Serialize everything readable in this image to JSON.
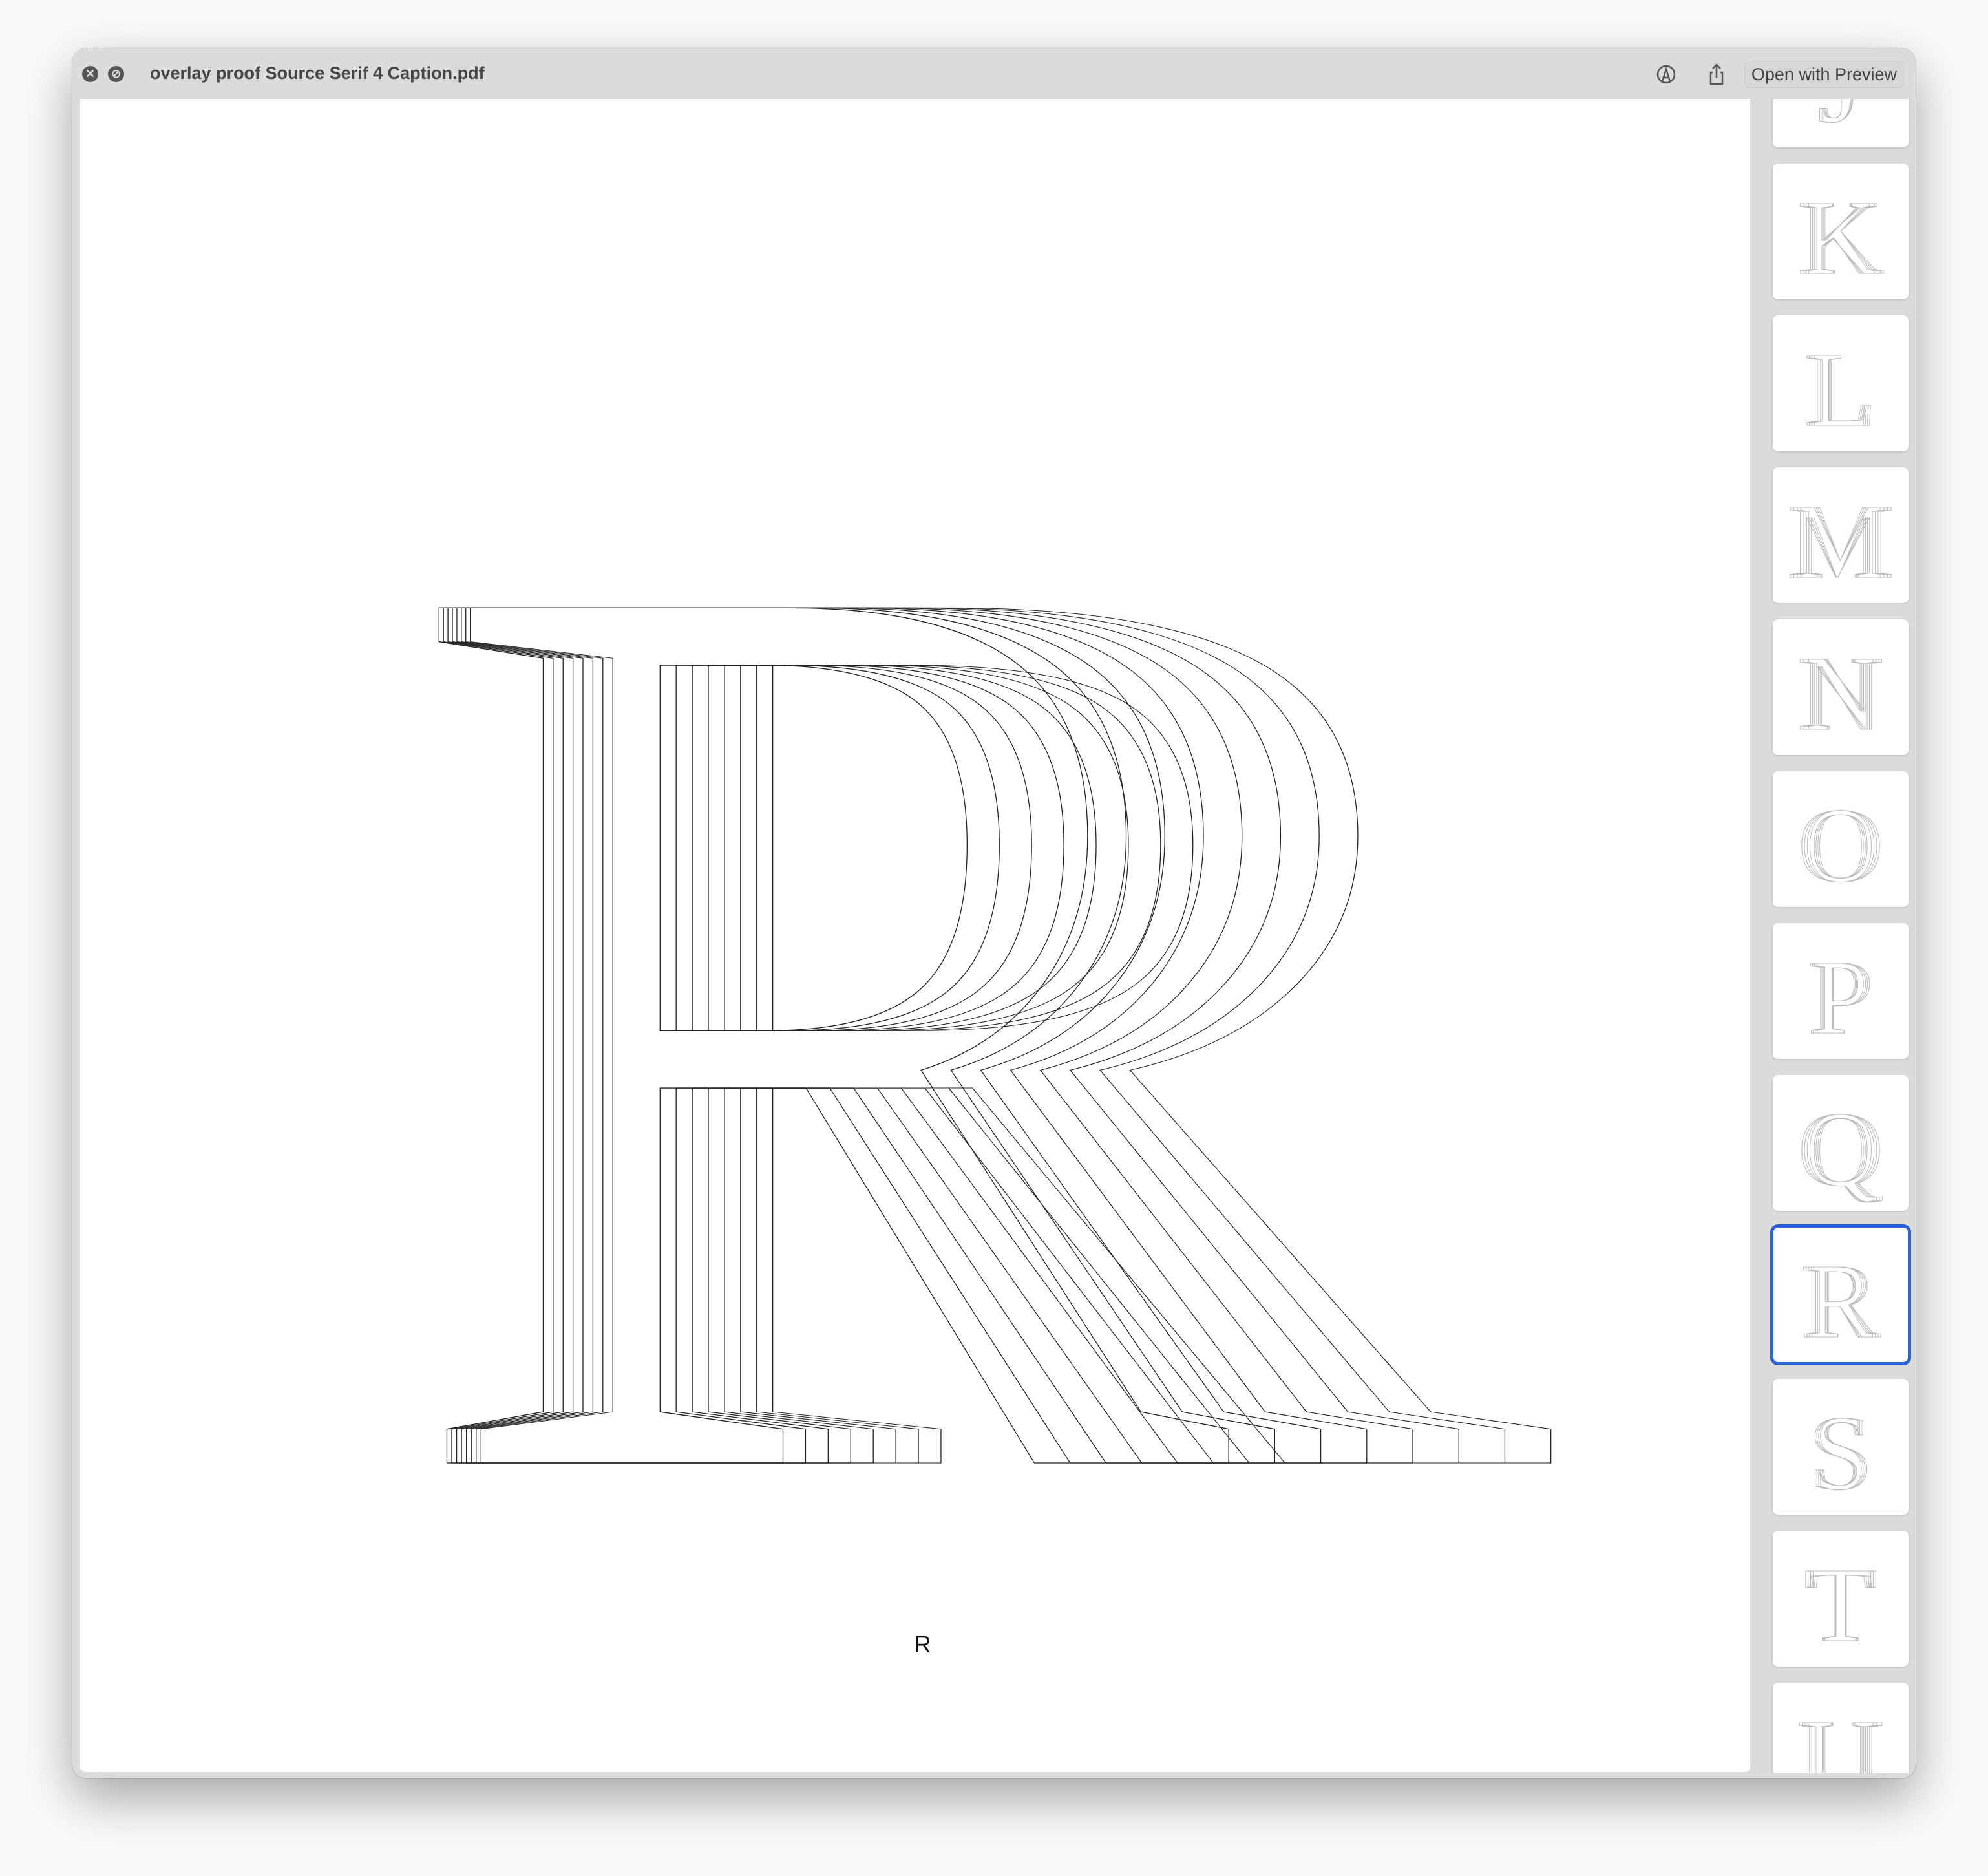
{
  "window": {
    "title": "overlay proof Source Serif 4 Caption.pdf",
    "open_with_label": "Open with Preview",
    "icons": [
      "close-icon",
      "minimize-icon",
      "markup-icon",
      "share-icon"
    ]
  },
  "page": {
    "glyph": "R",
    "caption": "R",
    "overlay_count": 8
  },
  "sidebar": {
    "thumbnails": [
      "J",
      "K",
      "L",
      "M",
      "N",
      "O",
      "P",
      "Q",
      "R",
      "S",
      "T",
      "U"
    ],
    "selected": "R",
    "accent": "#2a62d9"
  }
}
